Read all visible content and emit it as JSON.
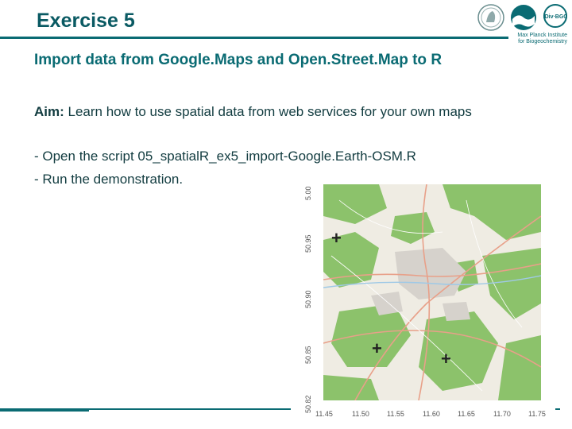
{
  "slide": {
    "title": "Exercise 5",
    "subtitle": "Import data from Google.Maps and Open.Street.Map to R",
    "aim_label": "Aim:",
    "aim_text": " Learn how to use spatial data from web services for your own maps",
    "bullets": [
      "- Open the script 05_spatialR_ex5_import-Google.Earth-OSM.R",
      "- Run the demonstration."
    ]
  },
  "header": {
    "institute_line1": "Max Planck Institute",
    "institute_line2": "for Biogeochemistry",
    "idiv_label": "iDiv·BGC"
  },
  "map": {
    "y_ticks": [
      "5.00",
      "50.95",
      "50.90",
      "50.85",
      "50.82"
    ],
    "x_ticks": [
      "11.45",
      "11.50",
      "11.55",
      "11.60",
      "11.65",
      "11.70",
      "11.75"
    ],
    "markers": [
      "+",
      "+",
      "+"
    ],
    "colors": {
      "forest": "#8cc26b",
      "urban": "#d6d2cc",
      "road": "#e8a089",
      "water": "#9fc9e6"
    }
  }
}
